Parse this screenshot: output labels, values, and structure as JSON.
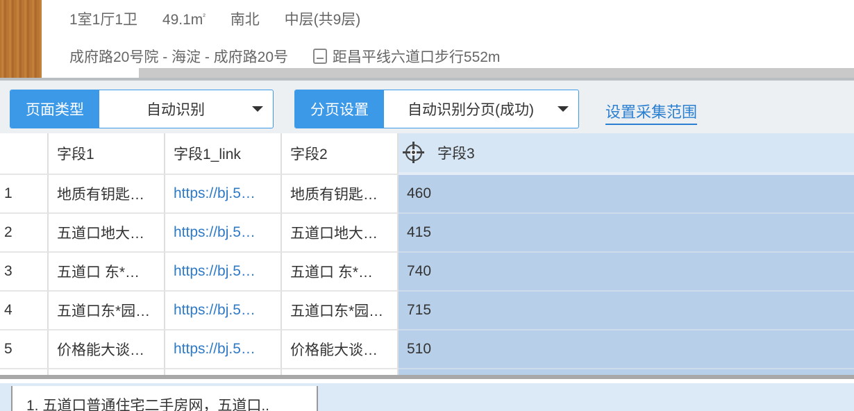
{
  "listing": {
    "line1": [
      "1室1厅1卫",
      "49.1m",
      "南北",
      "中层(共9层)"
    ],
    "area_sup": "²",
    "address": "成府路20号院 - 海淀 - 成府路20号",
    "subway": "距昌平线六道口步行552m"
  },
  "toolbar": {
    "page_type_label": "页面类型",
    "page_type_value": "自动识别",
    "paging_label": "分页设置",
    "paging_value": "自动识别分页(成功)",
    "range_link": "设置采集范围"
  },
  "table": {
    "headers": [
      "",
      "字段1",
      "字段1_link",
      "字段2",
      "字段3"
    ],
    "rows": [
      {
        "n": "1",
        "f1": "地质有钥匙…",
        "link": "https://bj.5…",
        "f2": "地质有钥匙…",
        "f3": "460"
      },
      {
        "n": "2",
        "f1": "五道口地大…",
        "link": "https://bj.5…",
        "f2": "五道口地大…",
        "f3": "415"
      },
      {
        "n": "3",
        "f1": "五道口 东*…",
        "link": "https://bj.5…",
        "f2": "五道口 东*…",
        "f3": "740"
      },
      {
        "n": "4",
        "f1": "五道口东*园…",
        "link": "https://bj.5…",
        "f2": "五道口东*园…",
        "f3": "715"
      },
      {
        "n": "5",
        "f1": "价格能大谈…",
        "link": "https://bj.5…",
        "f2": "价格能大谈…",
        "f3": "510"
      }
    ]
  },
  "bottom": {
    "item": "1. 五道口普通住宅二手房网，五道口.."
  },
  "colors": {
    "accent": "#3c99e8",
    "selected_column": "#b8cfe9",
    "link": "#2e7ac6"
  }
}
